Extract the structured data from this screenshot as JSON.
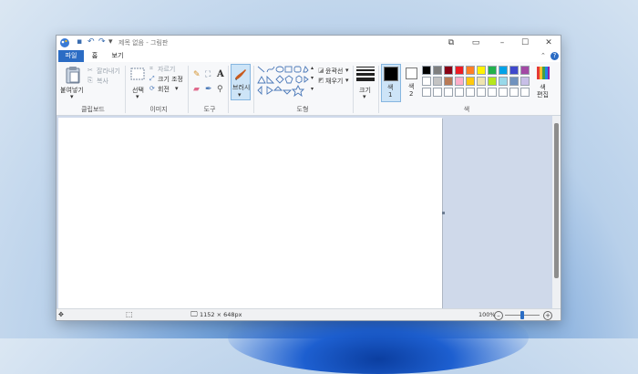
{
  "window": {
    "title": "제목 없음 - 그림판"
  },
  "tabs": [
    {
      "label": "파일"
    },
    {
      "label": "홈"
    },
    {
      "label": "보기"
    }
  ],
  "clipboard": {
    "paste": "붙여넣기",
    "cut": "잘라내기",
    "copy": "복사",
    "label": "클립보드"
  },
  "image": {
    "select": "선택",
    "crop": "자르기",
    "resize": "크기 조정",
    "rotate": "회전",
    "label": "이미지"
  },
  "tools": {
    "label": "도구"
  },
  "brushes": {
    "label": "브러시"
  },
  "shapes": {
    "outline": "윤곽선",
    "fill": "채우기",
    "label": "도형"
  },
  "size": {
    "label": "크기"
  },
  "colors": {
    "color1": "색\n1",
    "color2": "색\n2",
    "edit": "색\n편집",
    "label": "색",
    "row1": [
      "#000000",
      "#7f7f7f",
      "#880015",
      "#ed1c24",
      "#ff7f27",
      "#fff200",
      "#22b14c",
      "#00a2e8",
      "#3f48cc",
      "#a349a4"
    ],
    "row2": [
      "#ffffff",
      "#c3c3c3",
      "#b97a57",
      "#ffaec9",
      "#ffc90e",
      "#efe4b0",
      "#b5e61d",
      "#99d9ea",
      "#7092be",
      "#c8bfe7"
    ],
    "row3": [
      "#ffffff",
      "#ffffff",
      "#ffffff",
      "#ffffff",
      "#ffffff",
      "#ffffff",
      "#ffffff",
      "#ffffff",
      "#ffffff",
      "#ffffff"
    ],
    "fg": "#000000",
    "bg": "#ffffff",
    "accent": "#2b6cc4"
  },
  "status": {
    "dimensions": "1152 × 648px",
    "zoom": "100%",
    "zoom_level": 0.5
  }
}
